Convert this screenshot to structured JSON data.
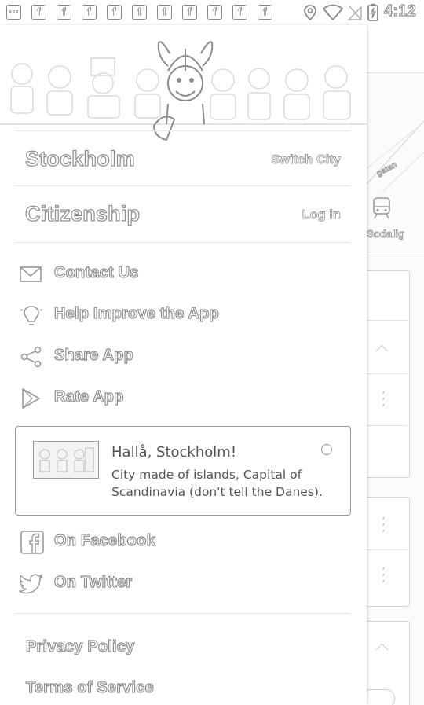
{
  "status_bar": {
    "notifications": [
      "more-notifications-icon",
      "facebook-icon",
      "facebook-icon",
      "facebook-icon",
      "facebook-icon",
      "facebook-icon",
      "facebook-icon",
      "facebook-icon",
      "facebook-icon",
      "facebook-icon",
      "facebook-icon"
    ],
    "time": "4:12"
  },
  "drawer": {
    "city": {
      "name": "Stockholm",
      "action": "Switch City"
    },
    "account": {
      "title": "Citizenship",
      "action": "Log in"
    },
    "menu": [
      {
        "icon": "mail-icon",
        "label": "Contact Us"
      },
      {
        "icon": "lightbulb-icon",
        "label": "Help Improve the App"
      },
      {
        "icon": "share-icon",
        "label": "Share App"
      },
      {
        "icon": "play-store-icon",
        "label": "Rate App"
      }
    ],
    "promo": {
      "title": "Hallå, Stockholm!",
      "description": "City made of islands, Capital of Scandinavia (don't tell the Danes)."
    },
    "social": [
      {
        "icon": "facebook-icon",
        "label": "On Facebook"
      },
      {
        "icon": "twitter-icon",
        "label": "On Twitter"
      }
    ],
    "legal": [
      {
        "label": "Privacy Policy"
      },
      {
        "label": "Terms of Service"
      }
    ]
  },
  "background_app": {
    "tab_label": "Sodalig",
    "map_text": "gatan"
  }
}
